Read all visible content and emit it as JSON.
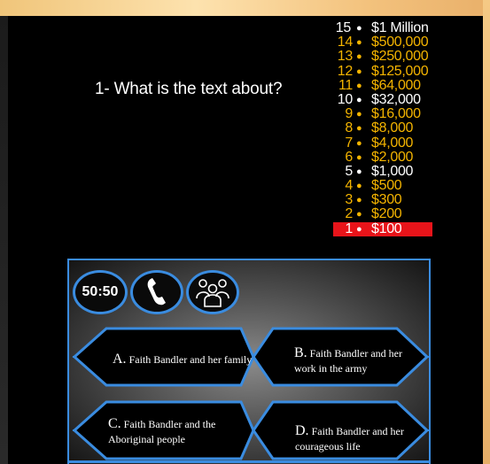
{
  "question": {
    "text": "1- What is the text about?"
  },
  "ladder": [
    {
      "level": "15",
      "amount": "$1 Million",
      "color": "white",
      "current": false
    },
    {
      "level": "14",
      "amount": "$500,000",
      "color": "gold",
      "current": false
    },
    {
      "level": "13",
      "amount": "$250,000",
      "color": "gold",
      "current": false
    },
    {
      "level": "12",
      "amount": "$125,000",
      "color": "gold",
      "current": false
    },
    {
      "level": "11",
      "amount": "$64,000",
      "color": "gold",
      "current": false
    },
    {
      "level": "10",
      "amount": "$32,000",
      "color": "white",
      "current": false
    },
    {
      "level": "9",
      "amount": "$16,000",
      "color": "gold",
      "current": false
    },
    {
      "level": "8",
      "amount": "$8,000",
      "color": "gold",
      "current": false
    },
    {
      "level": "7",
      "amount": "$4,000",
      "color": "gold",
      "current": false
    },
    {
      "level": "6",
      "amount": "$2,000",
      "color": "gold",
      "current": false
    },
    {
      "level": "5",
      "amount": "$1,000",
      "color": "white",
      "current": false
    },
    {
      "level": "4",
      "amount": "$500",
      "color": "gold",
      "current": false
    },
    {
      "level": "3",
      "amount": "$300",
      "color": "gold",
      "current": false
    },
    {
      "level": "2",
      "amount": "$200",
      "color": "gold",
      "current": false
    },
    {
      "level": "1",
      "amount": "$100",
      "color": "white",
      "current": true
    }
  ],
  "lifelines": {
    "fifty_label": "50:50",
    "phone_icon": "phone-icon",
    "audience_icon": "ask-audience-icon"
  },
  "answers": {
    "a": {
      "letter": "A.",
      "line1": "Faith Bandler and her family",
      "line2": ""
    },
    "b": {
      "letter": "B.",
      "line1": "Faith Bandler and her",
      "line2": "work in the army"
    },
    "c": {
      "letter": "C.",
      "line1": "Faith Bandler and the",
      "line2": "Aboriginal people"
    },
    "d": {
      "letter": "D.",
      "line1": "Faith Bandler and her",
      "line2": "courageous life"
    }
  },
  "colors": {
    "accent_blue": "#3a8ce0",
    "gold": "#f4b400",
    "current_level": "#e8141a",
    "frame": "#f5cd8a"
  }
}
